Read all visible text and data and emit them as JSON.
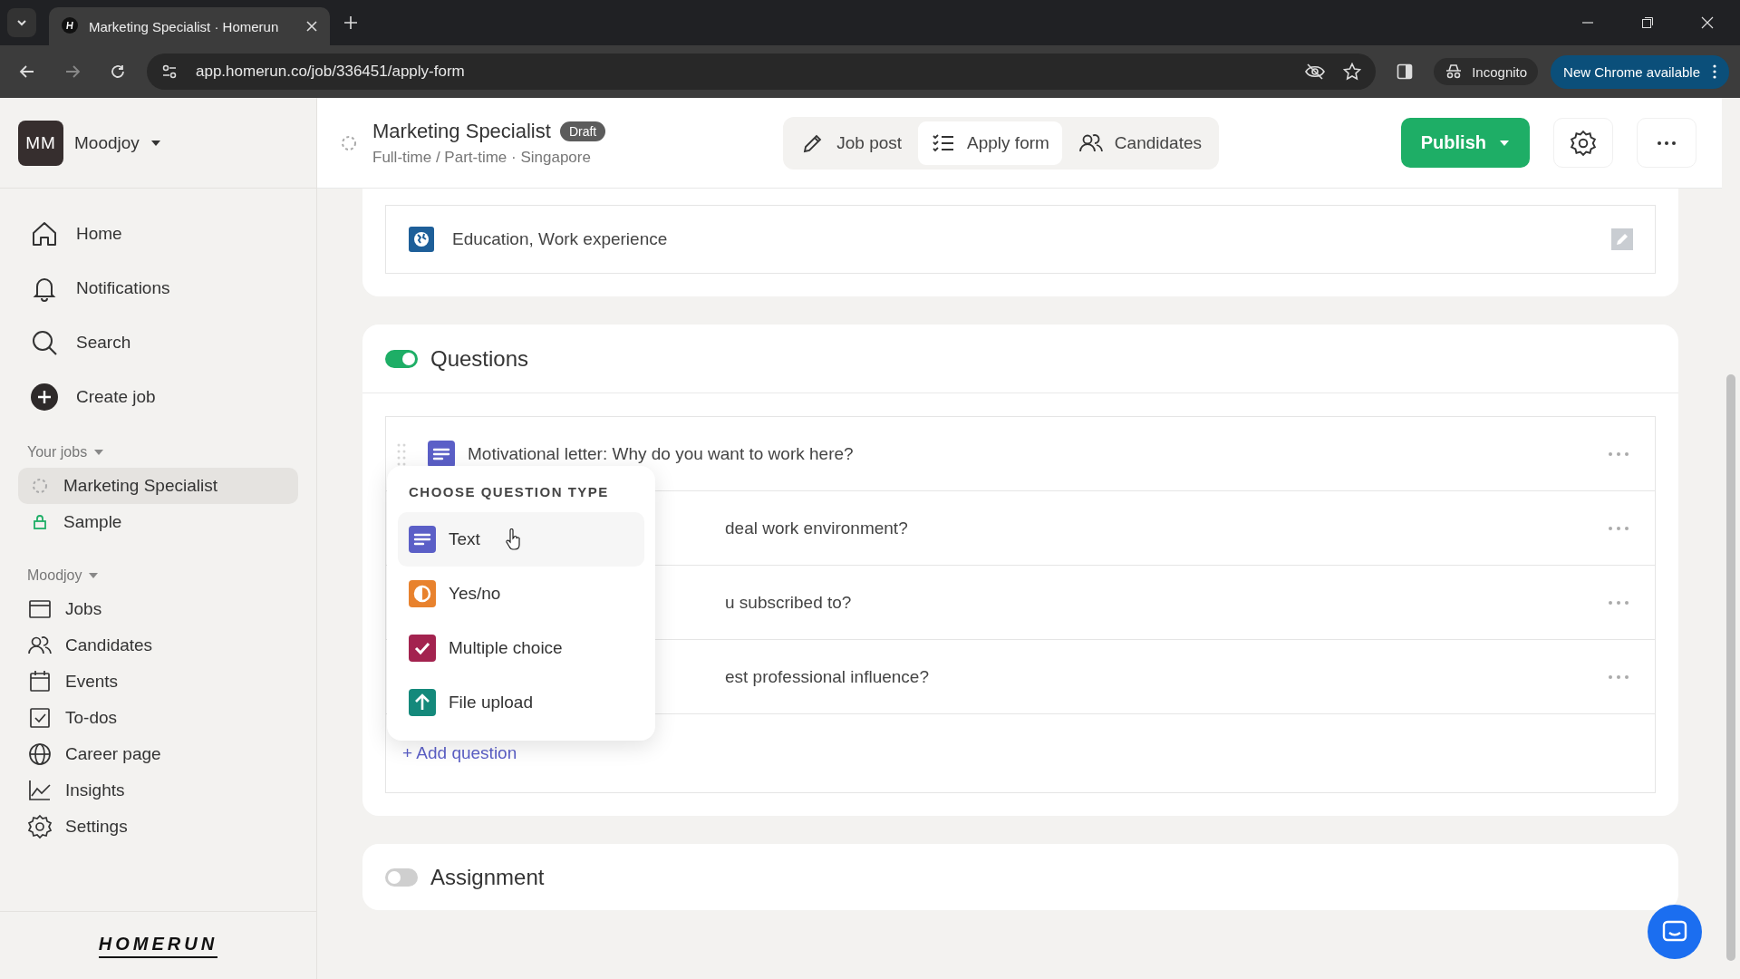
{
  "browser": {
    "tab_title": "Marketing Specialist · Homerun",
    "url": "app.homerun.co/job/336451/apply-form",
    "incognito": "Incognito",
    "update": "New Chrome available"
  },
  "sidebar": {
    "avatar": "MM",
    "company": "Moodjoy",
    "nav": [
      {
        "label": "Home",
        "kind": "home"
      },
      {
        "label": "Notifications",
        "kind": "bell"
      },
      {
        "label": "Search",
        "kind": "search"
      },
      {
        "label": "Create job",
        "kind": "plus"
      }
    ],
    "your_jobs": {
      "title": "Your jobs",
      "items": [
        {
          "label": "Marketing Specialist",
          "kind": "draft",
          "selected": true
        },
        {
          "label": "Sample",
          "kind": "lock",
          "selected": false
        }
      ]
    },
    "company_section": {
      "title": "Moodjoy",
      "items": [
        {
          "label": "Jobs",
          "kind": "jobs"
        },
        {
          "label": "Candidates",
          "kind": "people"
        },
        {
          "label": "Events",
          "kind": "calendar"
        },
        {
          "label": "To-dos",
          "kind": "todo"
        },
        {
          "label": "Career page",
          "kind": "globe"
        },
        {
          "label": "Insights",
          "kind": "chart"
        },
        {
          "label": "Settings",
          "kind": "gear"
        }
      ]
    },
    "logo": "HOMERUN"
  },
  "header": {
    "title": "Marketing Specialist",
    "badge": "Draft",
    "subtitle": "Full-time / Part-time · Singapore",
    "tabs": [
      {
        "label": "Job post",
        "kind": "pencil",
        "selected": false
      },
      {
        "label": "Apply form",
        "kind": "list",
        "selected": true
      },
      {
        "label": "Candidates",
        "kind": "people",
        "selected": false
      }
    ],
    "publish": "Publish"
  },
  "profile_row": {
    "text": "Education, Work experience"
  },
  "questions": {
    "title": "Questions",
    "on": true,
    "rows": [
      {
        "text": "Motivational letter: Why do you want to work here?"
      },
      {
        "text": "deal work environment?",
        "covered": true
      },
      {
        "text": "u subscribed to?",
        "covered": true
      },
      {
        "text": "est professional influence?",
        "covered": true
      }
    ],
    "add": "+ Add question"
  },
  "type_menu": {
    "title": "CHOOSE QUESTION TYPE",
    "items": [
      {
        "label": "Text",
        "kind": "text",
        "color": "#5b5fc7",
        "selected": true
      },
      {
        "label": "Yes/no",
        "kind": "yesno",
        "color": "#e8822e",
        "selected": false
      },
      {
        "label": "Multiple choice",
        "kind": "check",
        "color": "#a3234f",
        "selected": false
      },
      {
        "label": "File upload",
        "kind": "upload",
        "color": "#14897b",
        "selected": false
      }
    ]
  },
  "assignment": {
    "title": "Assignment",
    "on": false
  }
}
